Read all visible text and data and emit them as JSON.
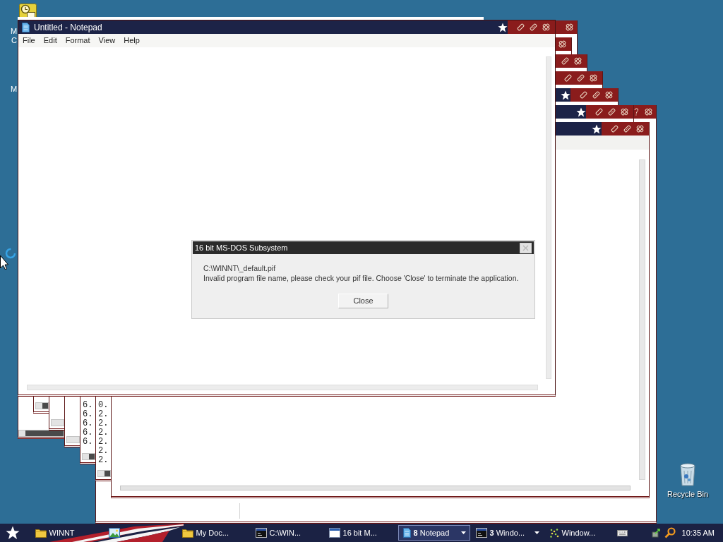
{
  "desktop_icons": [
    {
      "kind": "clock_tile",
      "label_lines": [
        "M",
        "C"
      ]
    },
    {
      "kind": "covered",
      "label_lines": [
        "M"
      ]
    },
    {
      "kind": "recycle_bin",
      "label_lines": [
        "Recycle Bin"
      ]
    }
  ],
  "background_windows": [
    {
      "kind": "app"
    },
    {
      "kind": "dialog"
    },
    {
      "kind": "dialog"
    },
    {
      "kind": "app"
    },
    {
      "kind": "app"
    },
    {
      "kind": "app"
    },
    {
      "kind": "app",
      "lines": [
        "6.",
        "6.",
        "6.",
        "6.",
        "6."
      ]
    },
    {
      "kind": "app",
      "lines": [
        "0.",
        "2.",
        "2.",
        "2.",
        "2.",
        "2.",
        "2."
      ]
    },
    {
      "kind": "app"
    }
  ],
  "notepad": {
    "title": "Untitled - Notepad",
    "menu": [
      "File",
      "Edit",
      "Format",
      "View",
      "Help"
    ]
  },
  "dialog": {
    "title": "16 bit MS-DOS Subsystem",
    "lines": [
      "C:\\WINNT\\_default.pif",
      "Invalid program file name, please check your pif file. Choose 'Close' to terminate the application."
    ],
    "button": "Close"
  },
  "taskbar": {
    "items": [
      {
        "kind": "folder",
        "label": "WINNT",
        "selected": false
      },
      {
        "kind": "picture",
        "selected": false
      },
      {
        "kind": "folder",
        "label": "My Doc...",
        "selected": false
      },
      {
        "kind": "console",
        "label": "C:\\WIN...",
        "selected": false
      },
      {
        "kind": "window",
        "label": "16 bit M...",
        "selected": false
      },
      {
        "kind": "page",
        "count": "8",
        "label": "Notepad",
        "selected": true
      },
      {
        "kind": "console",
        "count": "3",
        "label": "Windo...",
        "selected": false
      },
      {
        "kind": "dots",
        "label": "Window...",
        "selected": false
      }
    ],
    "clock": "10:35 AM"
  }
}
